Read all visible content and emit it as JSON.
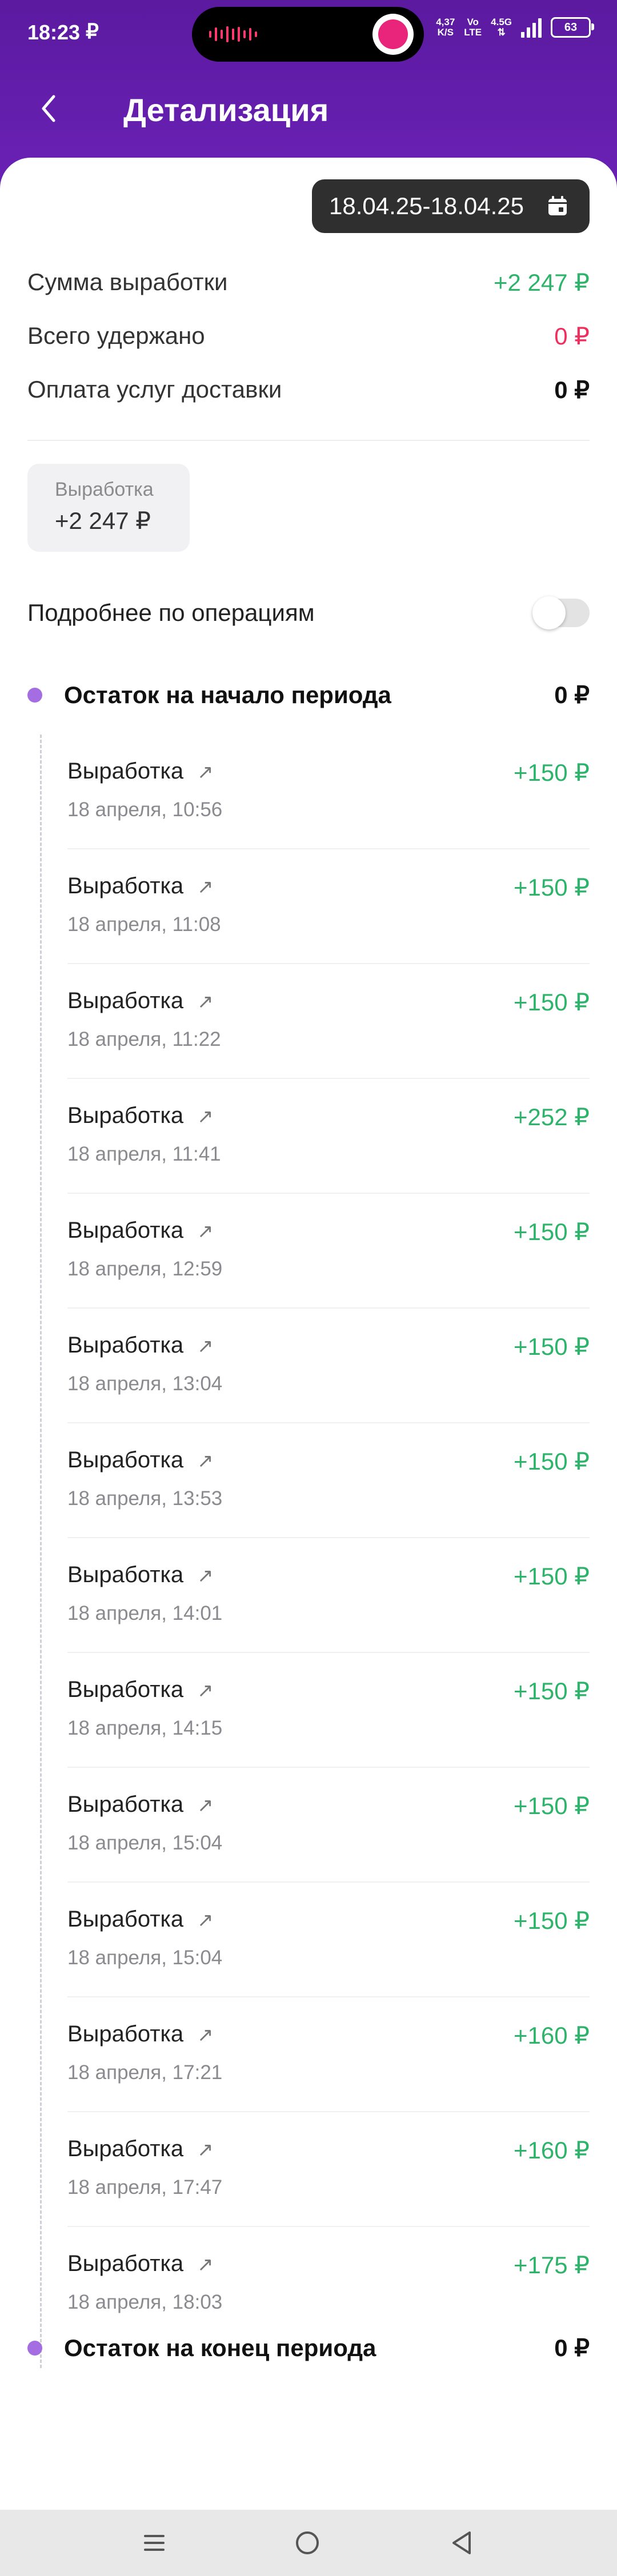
{
  "statusbar": {
    "time": "18:23",
    "carrier_icon": "₽",
    "speed_value": "4,37",
    "speed_unit": "K/S",
    "vo": "Vo",
    "lte": "LTE",
    "net": "4.5G",
    "battery": "63"
  },
  "header": {
    "title": "Детализация",
    "back_icon": "chevron-left-icon"
  },
  "date_range": {
    "label": "18.04.25-18.04.25",
    "icon": "calendar-icon"
  },
  "summary": [
    {
      "label": "Сумма выработки",
      "value": "+2 247 ₽"
    },
    {
      "label": "Всего удержано",
      "value": "0 ₽"
    },
    {
      "label": "Оплата услуг доставки",
      "value": "0 ₽"
    }
  ],
  "earnings_pill": {
    "label": "Выработка",
    "value": "+2 247 ₽"
  },
  "details_toggle": {
    "label": "Подробнее по операциям",
    "on": false
  },
  "period_start": {
    "label": "Остаток на начало периода",
    "value": "0 ₽"
  },
  "period_end": {
    "label": "Остаток на конец периода",
    "value": "0 ₽"
  },
  "operations": [
    {
      "name": "Выработка",
      "date": "18 апреля, 10:56",
      "amount": "+150 ₽"
    },
    {
      "name": "Выработка",
      "date": "18 апреля, 11:08",
      "amount": "+150 ₽"
    },
    {
      "name": "Выработка",
      "date": "18 апреля, 11:22",
      "amount": "+150 ₽"
    },
    {
      "name": "Выработка",
      "date": "18 апреля, 11:41",
      "amount": "+252 ₽"
    },
    {
      "name": "Выработка",
      "date": "18 апреля, 12:59",
      "amount": "+150 ₽"
    },
    {
      "name": "Выработка",
      "date": "18 апреля, 13:04",
      "amount": "+150 ₽"
    },
    {
      "name": "Выработка",
      "date": "18 апреля, 13:53",
      "amount": "+150 ₽"
    },
    {
      "name": "Выработка",
      "date": "18 апреля, 14:01",
      "amount": "+150 ₽"
    },
    {
      "name": "Выработка",
      "date": "18 апреля, 14:15",
      "amount": "+150 ₽"
    },
    {
      "name": "Выработка",
      "date": "18 апреля, 15:04",
      "amount": "+150 ₽"
    },
    {
      "name": "Выработка",
      "date": "18 апреля, 15:04",
      "amount": "+150 ₽"
    },
    {
      "name": "Выработка",
      "date": "18 апреля, 17:21",
      "amount": "+160 ₽"
    },
    {
      "name": "Выработка",
      "date": "18 апреля, 17:47",
      "amount": "+160 ₽"
    },
    {
      "name": "Выработка",
      "date": "18 апреля, 18:03",
      "amount": "+175 ₽"
    }
  ],
  "colors": {
    "header": "#6a21b5",
    "positive": "#2db36a",
    "negative": "#ee2f5e",
    "timeline_dot": "#a56de2"
  },
  "navbar": {
    "icons": [
      "menu-icon",
      "home-circle-icon",
      "back-triangle-icon"
    ]
  }
}
